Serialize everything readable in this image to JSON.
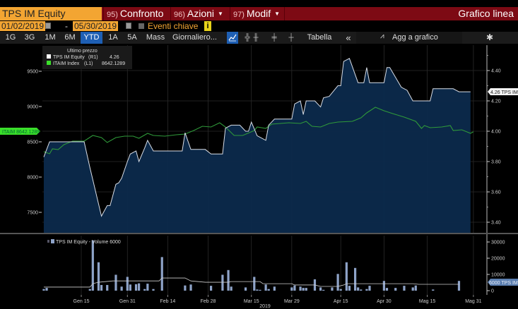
{
  "header": {
    "security": "TPS IM Equity",
    "menus": [
      {
        "num": "95)",
        "label": "Confronto",
        "dropdown": false
      },
      {
        "num": "96)",
        "label": "Azioni",
        "dropdown": true
      },
      {
        "num": "97)",
        "label": "Modif",
        "dropdown": true
      }
    ],
    "chart_type": "Grafico linea"
  },
  "date_range": {
    "start": "01/02/2019",
    "separator": "-",
    "end": "05/30/2019",
    "key_events_label": "Eventi chiave",
    "key_events_checked": false,
    "info_icon": "i"
  },
  "toolbar": {
    "periods": [
      "1G",
      "3G",
      "1M",
      "6M",
      "YTD",
      "1A",
      "5A",
      "Mass"
    ],
    "selected_period": "YTD",
    "frequency": "Giornaliero...",
    "chart_styles": [
      "line-chart-icon",
      "ohlc-bar-icon",
      "candlestick-icon",
      "hollow-candle-icon",
      "hlc-bar-icon"
    ],
    "selected_style": "line-chart-icon",
    "table_label": "Tabella",
    "collapse_label": "«",
    "add_label": "Agg a grafico",
    "settings_icon": "gear-icon"
  },
  "colors": {
    "accent_orange": "#f3a532",
    "header_red": "#7d0a14",
    "selected_blue": "#1e5fb4",
    "price_line": "#d8dde6",
    "price_fill": "#0c2a4c",
    "index_line": "#2f9a3a",
    "index_tag": "#3adf2a",
    "volume_bar": "#8ea3c8"
  },
  "chart_data": [
    {
      "type": "area",
      "legend": {
        "title": "Ultimo prezzo",
        "placement": "top-left",
        "entries": [
          {
            "name": "TPS IM Equity",
            "axis": "(R1)",
            "last": "4.26"
          },
          {
            "name": "ITAIM Index",
            "axis": "(L1)",
            "last": "8642.1289"
          }
        ]
      },
      "left_axis": {
        "ticks": [
          "9500",
          "9000",
          "8500",
          "8000",
          "7500"
        ],
        "range": [
          7350,
          9870
        ]
      },
      "right_axis": {
        "ticks": [
          "4.40",
          "4.20",
          "4.00",
          "3.80",
          "3.60",
          "3.40"
        ],
        "range": [
          3.36,
          4.58
        ]
      },
      "grid": true,
      "left_tag": "ITAIM 8642.1289",
      "right_tag": "4.26 TPS IM",
      "series": [
        {
          "name": "TPS IM Equity",
          "axis": "right",
          "points": [
            [
              "2019-01-02",
              3.83
            ],
            [
              "2019-01-04",
              3.93
            ],
            [
              "2019-01-16",
              3.93
            ],
            [
              "2019-01-18",
              3.76
            ],
            [
              "2019-01-19",
              3.68
            ],
            [
              "2019-01-22",
              3.44
            ],
            [
              "2019-01-24",
              3.51
            ],
            [
              "2019-01-25",
              3.51
            ],
            [
              "2019-01-27",
              3.65
            ],
            [
              "2019-01-28",
              3.66
            ],
            [
              "2019-01-29",
              3.69
            ],
            [
              "2019-01-31",
              3.8
            ],
            [
              "2019-02-01",
              3.85
            ],
            [
              "2019-02-03",
              3.87
            ],
            [
              "2019-02-04",
              3.8
            ],
            [
              "2019-02-06",
              3.89
            ],
            [
              "2019-02-07",
              3.94
            ],
            [
              "2019-02-09",
              3.87
            ],
            [
              "2019-02-19",
              3.87
            ],
            [
              "2019-02-20",
              3.99
            ],
            [
              "2019-02-22",
              3.88
            ],
            [
              "2019-02-27",
              3.88
            ],
            [
              "2019-03-01",
              3.85
            ],
            [
              "2019-03-05",
              3.85
            ],
            [
              "2019-03-06",
              4.02
            ],
            [
              "2019-03-08",
              4.04
            ],
            [
              "2019-03-11",
              4.04
            ],
            [
              "2019-03-13",
              4.0
            ],
            [
              "2019-03-14",
              4.0
            ],
            [
              "2019-03-15",
              4.06
            ],
            [
              "2019-03-17",
              3.97
            ],
            [
              "2019-03-18",
              3.96
            ],
            [
              "2019-03-20",
              3.94
            ],
            [
              "2019-03-21",
              4.04
            ],
            [
              "2019-03-23",
              4.08
            ],
            [
              "2019-03-29",
              4.08
            ],
            [
              "2019-03-30",
              4.18
            ],
            [
              "2019-04-01",
              4.2
            ],
            [
              "2019-04-02",
              4.11
            ],
            [
              "2019-04-03",
              4.2
            ],
            [
              "2019-04-06",
              4.2
            ],
            [
              "2019-04-08",
              4.16
            ],
            [
              "2019-04-09",
              4.22
            ],
            [
              "2019-04-11",
              4.23
            ],
            [
              "2019-04-14",
              4.3
            ],
            [
              "2019-04-15",
              4.3
            ],
            [
              "2019-04-16",
              4.46
            ],
            [
              "2019-04-18",
              4.48
            ],
            [
              "2019-04-21",
              4.32
            ],
            [
              "2019-04-23",
              4.32
            ],
            [
              "2019-04-24",
              4.42
            ],
            [
              "2019-04-25",
              4.32
            ],
            [
              "2019-04-30",
              4.32
            ],
            [
              "2019-05-01",
              4.42
            ],
            [
              "2019-05-02",
              4.42
            ],
            [
              "2019-05-06",
              4.29
            ],
            [
              "2019-05-08",
              4.27
            ],
            [
              "2019-05-10",
              4.2
            ],
            [
              "2019-05-16",
              4.2
            ],
            [
              "2019-05-17",
              4.28
            ],
            [
              "2019-05-24",
              4.28
            ],
            [
              "2019-05-26",
              4.26
            ],
            [
              "2019-05-30",
              4.26
            ]
          ]
        },
        {
          "name": "ITAIM Index",
          "axis": "left",
          "points": [
            [
              "2019-01-02",
              8360
            ],
            [
              "2019-01-04",
              8330
            ],
            [
              "2019-01-05",
              8400
            ],
            [
              "2019-01-07",
              8390
            ],
            [
              "2019-01-09",
              8460
            ],
            [
              "2019-01-12",
              8510
            ],
            [
              "2019-01-16",
              8510
            ],
            [
              "2019-01-19",
              8590
            ],
            [
              "2019-01-22",
              8560
            ],
            [
              "2019-01-24",
              8490
            ],
            [
              "2019-01-27",
              8560
            ],
            [
              "2019-01-30",
              8580
            ],
            [
              "2019-02-02",
              8580
            ],
            [
              "2019-02-04",
              8550
            ],
            [
              "2019-02-07",
              8620
            ],
            [
              "2019-02-09",
              8590
            ],
            [
              "2019-02-13",
              8580
            ],
            [
              "2019-02-17",
              8600
            ],
            [
              "2019-02-20",
              8610
            ],
            [
              "2019-02-23",
              8660
            ],
            [
              "2019-02-26",
              8720
            ],
            [
              "2019-03-01",
              8710
            ],
            [
              "2019-03-04",
              8770
            ],
            [
              "2019-03-06",
              8710
            ],
            [
              "2019-03-09",
              8590
            ],
            [
              "2019-03-12",
              8590
            ],
            [
              "2019-03-16",
              8660
            ],
            [
              "2019-03-17",
              8710
            ],
            [
              "2019-03-20",
              8690
            ],
            [
              "2019-03-22",
              8750
            ],
            [
              "2019-03-28",
              8770
            ],
            [
              "2019-04-01",
              8760
            ],
            [
              "2019-04-03",
              8790
            ],
            [
              "2019-04-05",
              8720
            ],
            [
              "2019-04-08",
              8710
            ],
            [
              "2019-04-11",
              8760
            ],
            [
              "2019-04-14",
              8780
            ],
            [
              "2019-04-19",
              8790
            ],
            [
              "2019-04-22",
              8840
            ],
            [
              "2019-04-24",
              8910
            ],
            [
              "2019-04-27",
              8990
            ],
            [
              "2019-04-30",
              8940
            ],
            [
              "2019-05-03",
              8900
            ],
            [
              "2019-05-07",
              8850
            ],
            [
              "2019-05-11",
              8790
            ],
            [
              "2019-05-13",
              8690
            ],
            [
              "2019-05-14",
              8730
            ],
            [
              "2019-05-16",
              8700
            ],
            [
              "2019-05-20",
              8710
            ],
            [
              "2019-05-23",
              8730
            ],
            [
              "2019-05-24",
              8660
            ],
            [
              "2019-05-27",
              8670
            ],
            [
              "2019-05-30",
              8620
            ],
            [
              "2019-05-31",
              8642.13
            ]
          ]
        }
      ]
    },
    {
      "type": "bar",
      "legend": {
        "label": "TPS IM Equity - Volume 6000",
        "placement": "top-left"
      },
      "axis": {
        "ticks": [
          "30000",
          "20000",
          "10000",
          "0"
        ],
        "range": [
          0,
          34000
        ]
      },
      "right_tag": "6000 TPS IM",
      "x_ticks": [
        "Gen 15",
        "Gen 31",
        "Feb 14",
        "Feb 28",
        "Mar 15",
        "Mar 29",
        "Apr 15",
        "Apr 30",
        "Mag 15",
        "Mag 31"
      ],
      "x_year": "2019",
      "bars": [
        [
          "2019-01-02",
          1000
        ],
        [
          "2019-01-03",
          1700
        ],
        [
          "2019-01-18",
          1000
        ],
        [
          "2019-01-19",
          31000
        ],
        [
          "2019-01-21",
          17500
        ],
        [
          "2019-01-22",
          3500
        ],
        [
          "2019-01-24",
          3500
        ],
        [
          "2019-01-27",
          9800
        ],
        [
          "2019-01-29",
          2500
        ],
        [
          "2019-01-31",
          8500
        ],
        [
          "2019-02-01",
          3800
        ],
        [
          "2019-02-03",
          4000
        ],
        [
          "2019-02-04",
          4500
        ],
        [
          "2019-02-06",
          1000
        ],
        [
          "2019-02-07",
          4300
        ],
        [
          "2019-02-09",
          1000
        ],
        [
          "2019-02-12",
          20700
        ],
        [
          "2019-02-20",
          3200
        ],
        [
          "2019-02-22",
          3800
        ],
        [
          "2019-03-01",
          3000
        ],
        [
          "2019-03-05",
          9800
        ],
        [
          "2019-03-07",
          12700
        ],
        [
          "2019-03-08",
          2500
        ],
        [
          "2019-03-13",
          2000
        ],
        [
          "2019-03-16",
          8500
        ],
        [
          "2019-03-17",
          700
        ],
        [
          "2019-03-18",
          500
        ],
        [
          "2019-03-20",
          3800
        ],
        [
          "2019-03-21",
          1000
        ],
        [
          "2019-03-23",
          2500
        ],
        [
          "2019-03-29",
          2000
        ],
        [
          "2019-03-30",
          3200
        ],
        [
          "2019-04-01",
          2500
        ],
        [
          "2019-04-02",
          1700
        ],
        [
          "2019-04-03",
          1700
        ],
        [
          "2019-04-06",
          7000
        ],
        [
          "2019-04-08",
          2000
        ],
        [
          "2019-04-09",
          500
        ],
        [
          "2019-04-12",
          2000
        ],
        [
          "2019-04-14",
          10300
        ],
        [
          "2019-04-15",
          1000
        ],
        [
          "2019-04-17",
          17500
        ],
        [
          "2019-04-18",
          3000
        ],
        [
          "2019-04-20",
          14000
        ],
        [
          "2019-04-21",
          2000
        ],
        [
          "2019-04-22",
          700
        ],
        [
          "2019-04-24",
          1000
        ],
        [
          "2019-04-25",
          3000
        ],
        [
          "2019-04-30",
          6000
        ],
        [
          "2019-05-01",
          1700
        ],
        [
          "2019-05-04",
          1700
        ],
        [
          "2019-05-07",
          3000
        ],
        [
          "2019-05-10",
          2000
        ],
        [
          "2019-05-11",
          3200
        ],
        [
          "2019-05-17",
          700
        ],
        [
          "2019-05-26",
          6000
        ]
      ],
      "average_line": [
        [
          "2019-01-02",
          2200
        ],
        [
          "2019-01-18",
          2200
        ],
        [
          "2019-01-19",
          4300
        ],
        [
          "2019-01-21",
          5200
        ],
        [
          "2019-01-26",
          6000
        ],
        [
          "2019-02-11",
          6000
        ],
        [
          "2019-02-12",
          7800
        ],
        [
          "2019-02-20",
          7800
        ],
        [
          "2019-02-22",
          6000
        ],
        [
          "2019-02-27",
          5200
        ],
        [
          "2019-03-07",
          5200
        ],
        [
          "2019-03-08",
          5600
        ],
        [
          "2019-03-18",
          5600
        ],
        [
          "2019-03-19",
          4300
        ],
        [
          "2019-03-29",
          4300
        ],
        [
          "2019-03-30",
          3500
        ],
        [
          "2019-04-06",
          3500
        ],
        [
          "2019-04-08",
          2600
        ],
        [
          "2019-04-14",
          2600
        ],
        [
          "2019-04-16",
          3500
        ],
        [
          "2019-04-17",
          4300
        ],
        [
          "2019-05-10",
          4300
        ],
        [
          "2019-05-12",
          3900
        ],
        [
          "2019-05-26",
          3900
        ]
      ]
    }
  ]
}
